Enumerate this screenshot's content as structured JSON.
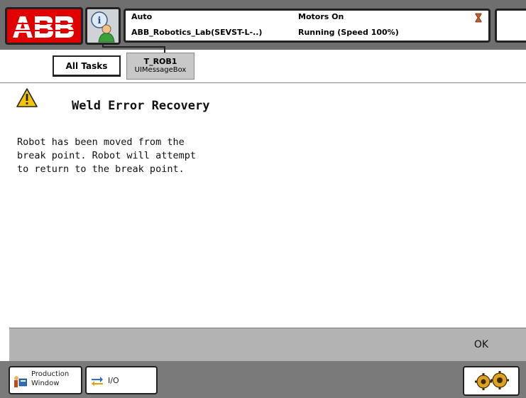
{
  "header": {
    "logo_text": "ABB",
    "operating_mode": "Auto",
    "system_name": "ABB_Robotics_Lab(SEVST-L-..)",
    "motor_state": "Motors On",
    "program_state": "Running (Speed 100%)"
  },
  "tabs": [
    {
      "label": "All Tasks"
    },
    {
      "label": "T_ROB1",
      "sublabel": "UIMessageBox"
    }
  ],
  "message": {
    "title": "Weld Error Recovery",
    "body_lines": [
      "Robot has been moved from the",
      "break point.  Robot will attempt",
      "to return to the break point."
    ]
  },
  "buttons": {
    "ok_label": "OK"
  },
  "taskbar": {
    "production_label_line1": "Production",
    "production_label_line2": "Window",
    "io_label": "I/O"
  },
  "colors": {
    "abb_red": "#e00000",
    "bar_gray": "#6f6f6f",
    "button_bar_gray": "#b3b3b3",
    "warning_yellow": "#f5c400"
  }
}
